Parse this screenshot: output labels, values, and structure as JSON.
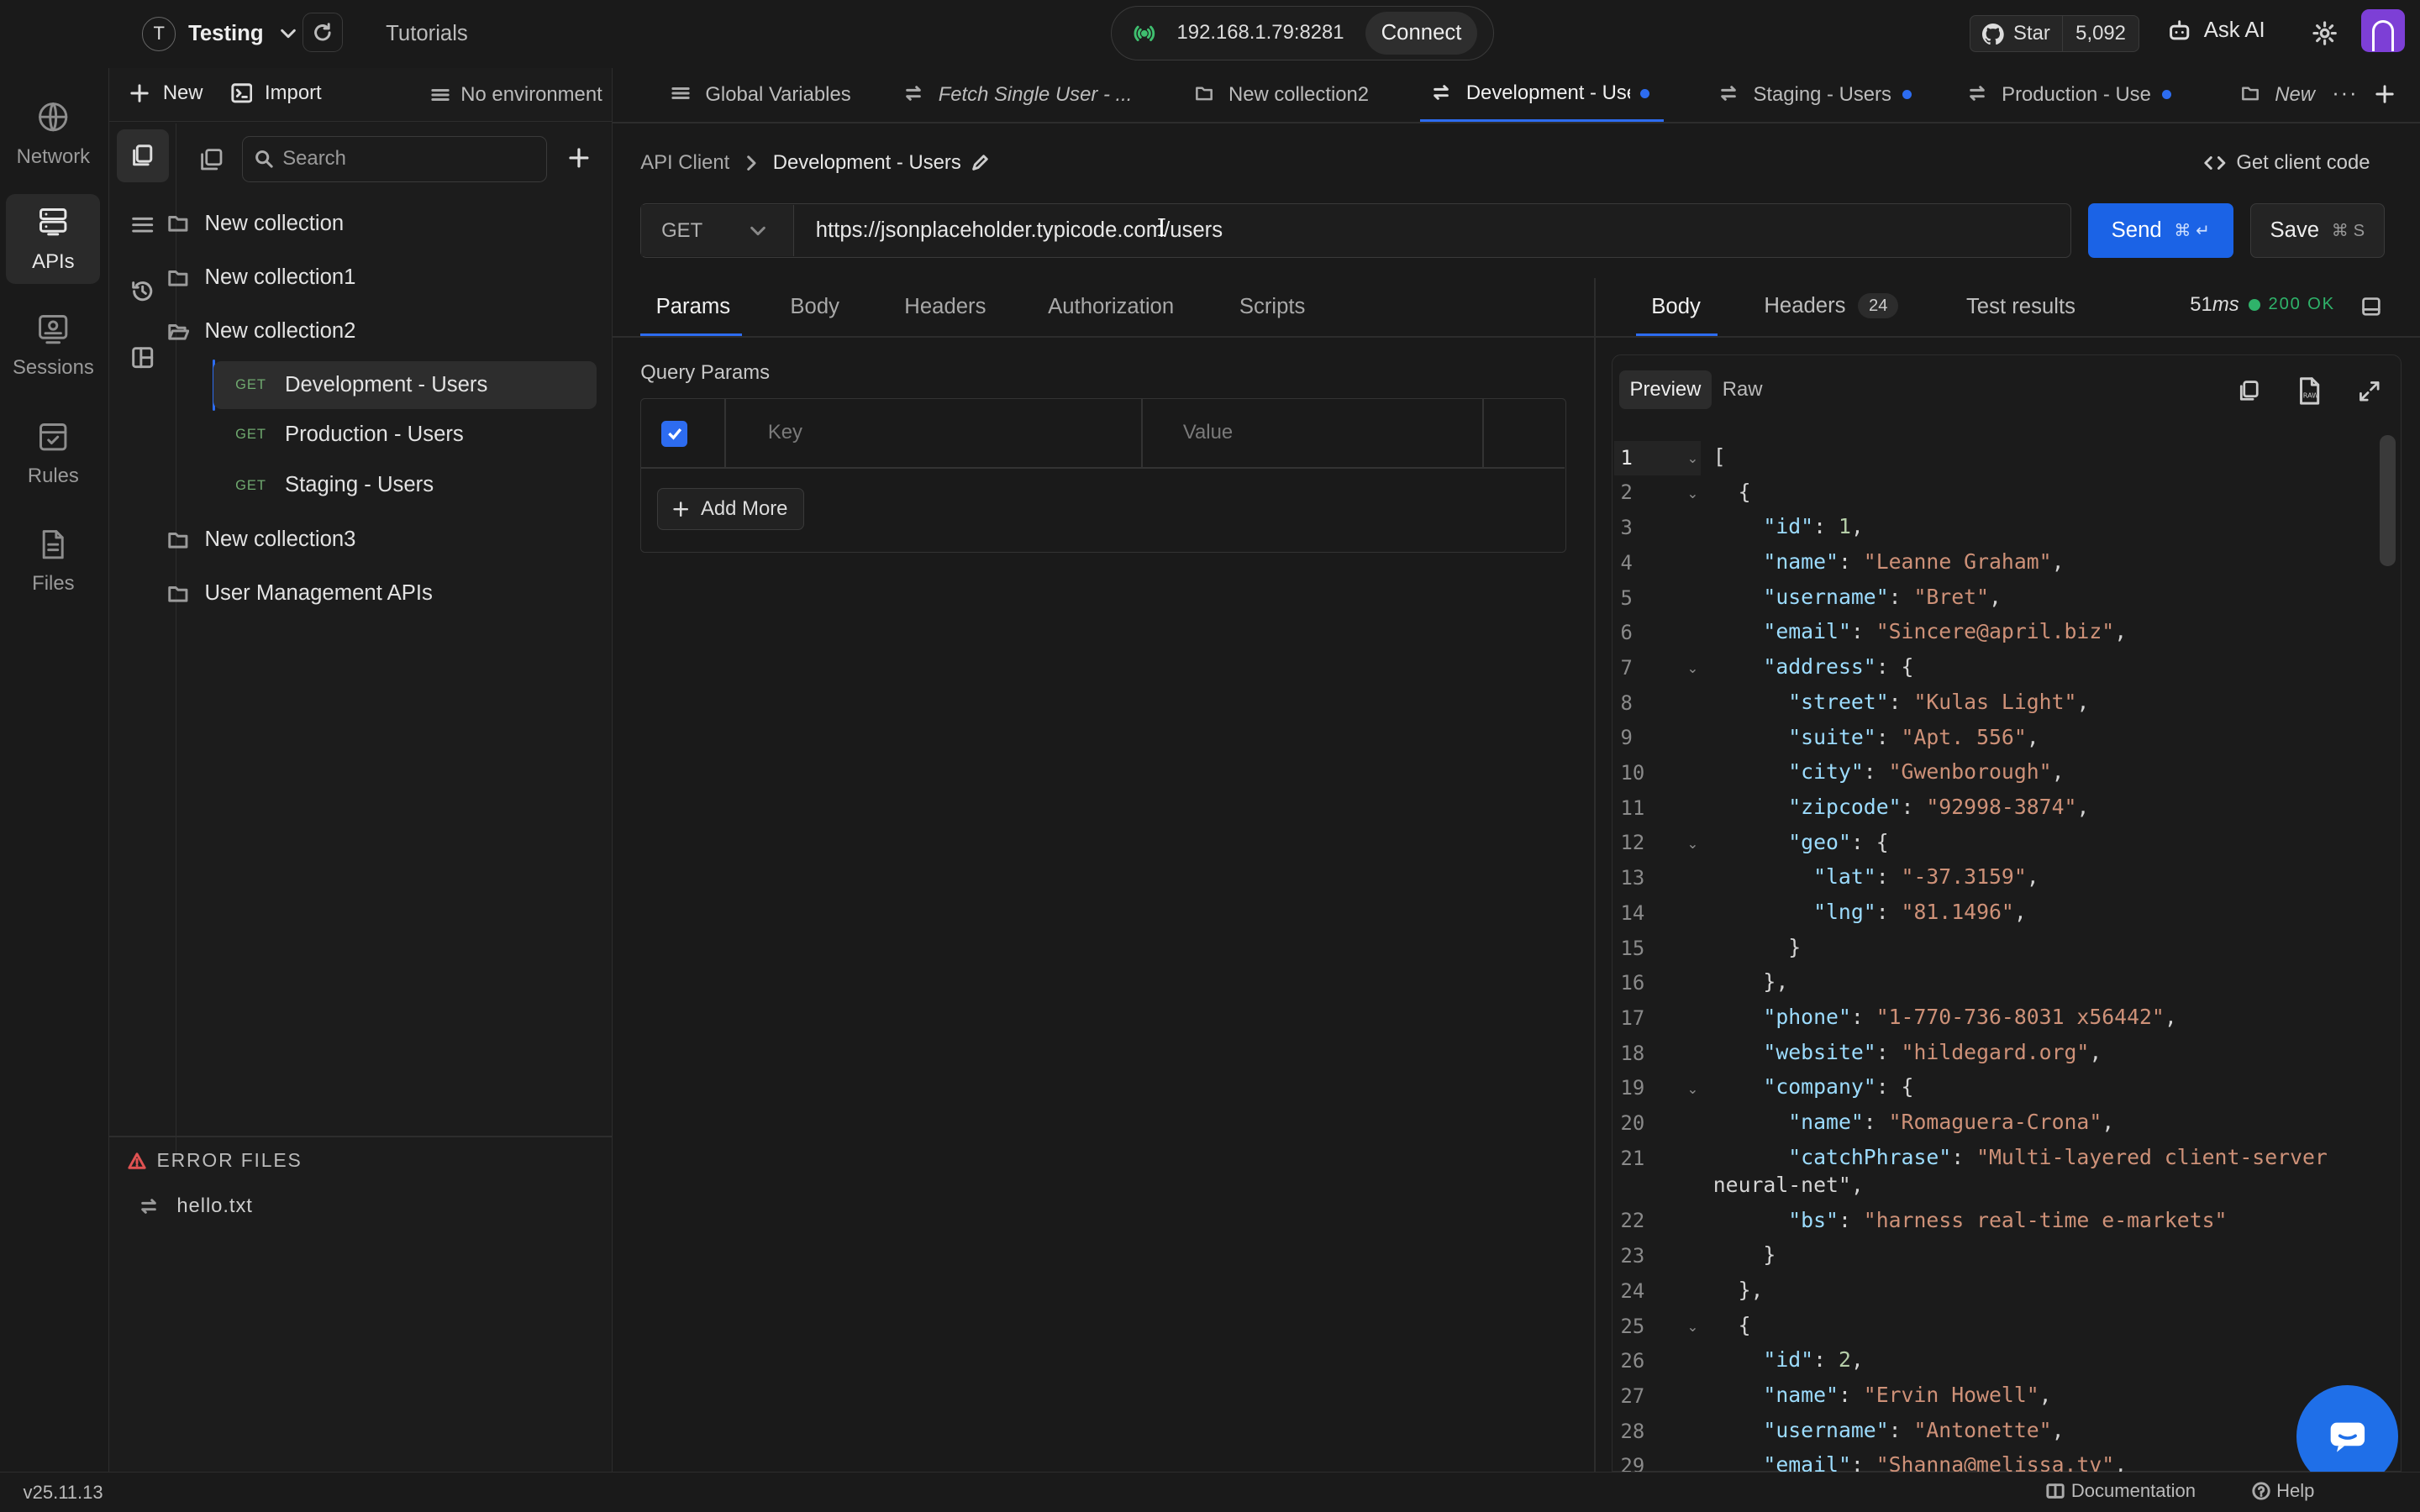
{
  "workspace": {
    "initial": "T",
    "name": "Testing"
  },
  "topbar": {
    "tutorials": "Tutorials",
    "ip": "192.168.1.79:8281",
    "connect": "Connect",
    "star": "Star",
    "star_count": "5,092",
    "ask_ai": "Ask AI"
  },
  "rail": {
    "items": [
      {
        "label": "Network"
      },
      {
        "label": "APIs"
      },
      {
        "label": "Sessions"
      },
      {
        "label": "Rules"
      },
      {
        "label": "Files"
      }
    ]
  },
  "sidebar": {
    "new": "New",
    "import": "Import",
    "environment": "No environment",
    "search_placeholder": "Search",
    "collections": [
      "New collection",
      "New collection1",
      "New collection2",
      "New collection3",
      "User Management APIs"
    ],
    "requests": [
      {
        "method": "GET",
        "name": "Development - Users"
      },
      {
        "method": "GET",
        "name": "Production - Users"
      },
      {
        "method": "GET",
        "name": "Staging - Users"
      }
    ],
    "error_files_title": "ERROR FILES",
    "error_file": "hello.txt"
  },
  "tabs": [
    "Global Variables",
    "Fetch Single User - ...",
    "New collection2",
    "Development - Use",
    "Staging - Users",
    "Production - Use",
    "New"
  ],
  "request": {
    "breadcrumb_root": "API Client",
    "breadcrumb_current": "Development - Users",
    "get_client_code": "Get client code",
    "method": "GET",
    "url": "https://jsonplaceholder.typicode.com/users",
    "send": "Send",
    "send_shortcut": "⌘ ↵",
    "save": "Save",
    "save_shortcut": "⌘ S",
    "subtabs": [
      "Params",
      "Body",
      "Headers",
      "Authorization",
      "Scripts"
    ],
    "query_params_title": "Query Params",
    "key_placeholder": "Key",
    "value_placeholder": "Value",
    "add_more": "Add More"
  },
  "response": {
    "tabs": {
      "body": "Body",
      "headers": "Headers",
      "headers_count": "24",
      "test_results": "Test results"
    },
    "time": "51",
    "time_unit": "ms",
    "status": "200 OK",
    "preview": "Preview",
    "raw": "Raw",
    "lines": [
      "[",
      "  {",
      "    \"id\": 1,",
      "    \"name\": \"Leanne Graham\",",
      "    \"username\": \"Bret\",",
      "    \"email\": \"Sincere@april.biz\",",
      "    \"address\": {",
      "      \"street\": \"Kulas Light\",",
      "      \"suite\": \"Apt. 556\",",
      "      \"city\": \"Gwenborough\",",
      "      \"zipcode\": \"92998-3874\",",
      "      \"geo\": {",
      "        \"lat\": \"-37.3159\",",
      "        \"lng\": \"81.1496\",",
      "      }",
      "    },",
      "    \"phone\": \"1-770-736-8031 x56442\",",
      "    \"website\": \"hildegard.org\",",
      "    \"company\": {",
      "      \"name\": \"Romaguera-Crona\",",
      "      \"catchPhrase\": \"Multi-layered client-server\nneural-net\",",
      "      \"bs\": \"harness real-time e-markets\"",
      "    }",
      "  },",
      "  {",
      "    \"id\": 2,",
      "    \"name\": \"Ervin Howell\",",
      "    \"username\": \"Antonette\",",
      "    \"email\": \"Shanna@melissa.tv\","
    ]
  },
  "footer": {
    "version": "v25.11.13",
    "documentation": "Documentation",
    "help": "Help"
  }
}
